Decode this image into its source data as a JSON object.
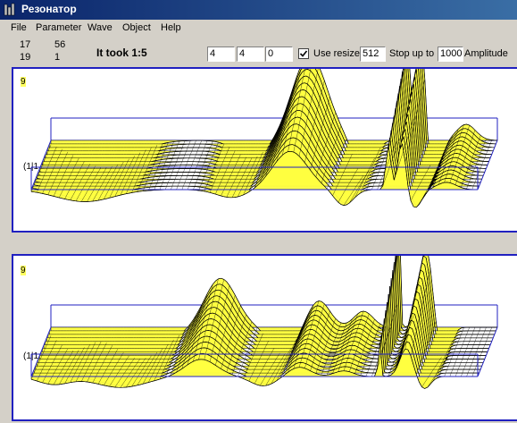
{
  "window": {
    "title": "Резонатор"
  },
  "menu": [
    "File",
    "Parameter",
    "Wave",
    "Object",
    "Help"
  ],
  "counters": {
    "r1c1": "17",
    "r1c2": "56",
    "r2c1": "19",
    "r2c2": "1"
  },
  "status": {
    "took": "It took 1:5"
  },
  "inputs": {
    "a": "4",
    "b": "4",
    "c": "0",
    "resize": "512",
    "stop": "1000"
  },
  "labels": {
    "use_resize": "Use resize",
    "stop_up_to": "Stop up to",
    "amplitude": "Amplitude"
  },
  "use_resize_checked": true,
  "panels": [
    {
      "label": "9",
      "axis": "(1|1,1)"
    },
    {
      "label": "9",
      "axis": "(1|1,1)"
    }
  ],
  "colors": {
    "surface": "#ffff40",
    "box": "#2020c0",
    "titlebar": "#0a246a"
  }
}
